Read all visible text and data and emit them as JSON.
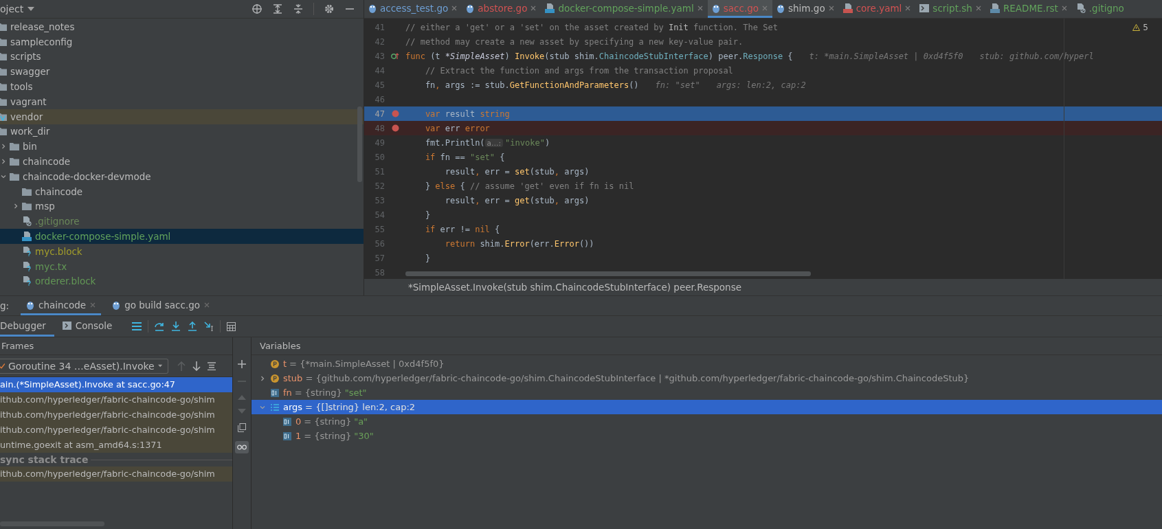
{
  "project_panel": {
    "title": "oject",
    "tree": [
      {
        "label": "release_notes",
        "kind": "folder",
        "selected": false
      },
      {
        "label": "sampleconfig",
        "kind": "folder",
        "selected": false
      },
      {
        "label": "scripts",
        "kind": "folder",
        "selected": false
      },
      {
        "label": "swagger",
        "kind": "folder",
        "selected": false
      },
      {
        "label": "tools",
        "kind": "folder",
        "selected": false
      },
      {
        "label": "vagrant",
        "kind": "folder",
        "selected": false
      },
      {
        "label": "vendor",
        "kind": "vendor",
        "selected": false
      },
      {
        "label": "work_dir",
        "kind": "folder",
        "selected": false,
        "children": [
          {
            "label": "bin",
            "kind": "folder",
            "expanded": false,
            "selected": false
          },
          {
            "label": "chaincode",
            "kind": "folder",
            "expanded": false,
            "selected": false
          },
          {
            "label": "chaincode-docker-devmode",
            "kind": "folder",
            "expanded": true,
            "selected": false,
            "children": [
              {
                "label": "chaincode",
                "kind": "folder",
                "selected": false
              },
              {
                "label": "msp",
                "kind": "folder",
                "expanded": false,
                "selected": false
              },
              {
                "label": ".gitignore",
                "kind": "ignored",
                "color": "#6a8759",
                "selected": false
              },
              {
                "label": "docker-compose-simple.yaml",
                "kind": "compose",
                "color": "#62a35c",
                "selected": true
              },
              {
                "label": "myc.block",
                "kind": "unknown",
                "color": "#a39e2a",
                "selected": false
              },
              {
                "label": "myc.tx",
                "kind": "unknown",
                "color": "#629755",
                "selected": false
              },
              {
                "label": "orderer.block",
                "kind": "unknown",
                "color": "#629755",
                "selected": false
              }
            ]
          }
        ]
      }
    ]
  },
  "editor": {
    "tabs": [
      {
        "label": "access_test.go",
        "kind": "go",
        "color": "#6e9fd4",
        "selected": false
      },
      {
        "label": "abstore.go",
        "kind": "go",
        "color": "#d25252",
        "selected": false
      },
      {
        "label": "docker-compose-simple.yaml",
        "kind": "compose",
        "color": "#62a35c",
        "selected": false
      },
      {
        "label": "sacc.go",
        "kind": "go",
        "color": "#d25252",
        "selected": true
      },
      {
        "label": "shim.go",
        "kind": "go",
        "color": "#bbbbbb",
        "selected": false
      },
      {
        "label": "core.yaml",
        "kind": "yaml",
        "color": "#d25252",
        "selected": false
      },
      {
        "label": "script.sh",
        "kind": "shell",
        "color": "#62a35c",
        "selected": false
      },
      {
        "label": "README.rst",
        "kind": "rst",
        "color": "#62a35c",
        "selected": false
      },
      {
        "label": ".gitigno",
        "kind": "ignored",
        "color": "#62a35c",
        "selected": false
      }
    ],
    "warnings": "5",
    "lines": [
      {
        "number": "41",
        "breakpoint": false,
        "current": false,
        "tokens": [
          {
            "kind": "cm",
            "text": "// either a 'get' or a 'set' on the asset created by "
          },
          {
            "kind": "cmref",
            "text": "Init"
          },
          {
            "kind": "cm",
            "text": " function. The Set"
          }
        ]
      },
      {
        "number": "42",
        "breakpoint": false,
        "current": false,
        "tokens": [
          {
            "kind": "cm",
            "text": "// method may create a new asset by specifying a new key-value pair."
          }
        ]
      },
      {
        "number": "43",
        "breakpoint": false,
        "current": false,
        "kind": "implements",
        "tokens": [
          {
            "kind": "kw",
            "text": "func"
          },
          {
            "kind": "id",
            "text": " (t "
          },
          {
            "kind": "type",
            "text": "*SimpleAsset"
          },
          {
            "kind": "id",
            "text": ") "
          },
          {
            "kind": "fn",
            "text": "Invoke"
          },
          {
            "kind": "id",
            "text": "(stub shim."
          },
          {
            "kind": "iface",
            "text": "ChaincodeStubInterface"
          },
          {
            "kind": "id",
            "text": ") peer."
          },
          {
            "kind": "iface",
            "text": "Response"
          },
          {
            "kind": "id",
            "text": " {"
          },
          {
            "kind": "hint",
            "text": "t: *main.SimpleAsset | 0xd4f5f0"
          },
          {
            "kind": "hint",
            "text": "stub: github.com/hyperl"
          }
        ]
      },
      {
        "number": "44",
        "breakpoint": false,
        "current": false,
        "tokens": [
          {
            "kind": "cm",
            "text": "    // Extract the function and args from the transaction proposal"
          }
        ]
      },
      {
        "number": "45",
        "breakpoint": false,
        "current": false,
        "tokens": [
          {
            "kind": "id",
            "text": "    fn"
          },
          {
            "kind": "kw",
            "text": ","
          },
          {
            "kind": "id",
            "text": " args := stub."
          },
          {
            "kind": "fn",
            "text": "GetFunctionAndParameters"
          },
          {
            "kind": "id",
            "text": "()"
          },
          {
            "kind": "hint",
            "text": "fn: \"set\""
          },
          {
            "kind": "hint",
            "text": "args: len:2, cap:2"
          }
        ]
      },
      {
        "number": "46",
        "breakpoint": false,
        "current": false
      },
      {
        "number": "47",
        "breakpoint": true,
        "current": true,
        "tokens": [
          {
            "kind": "kw",
            "text": "    var"
          },
          {
            "kind": "id",
            "text": " result "
          },
          {
            "kind": "kw",
            "text": "string"
          }
        ]
      },
      {
        "number": "48",
        "breakpoint": true,
        "current": false,
        "tokens": [
          {
            "kind": "kw",
            "text": "    var"
          },
          {
            "kind": "id",
            "text": " err "
          },
          {
            "kind": "kw",
            "text": "error"
          }
        ]
      },
      {
        "number": "49",
        "breakpoint": false,
        "current": false,
        "tokens": [
          {
            "kind": "id",
            "text": "    fmt.Println("
          },
          {
            "kind": "param",
            "text": "a…:"
          },
          {
            "kind": "str",
            "text": "\"invoke\""
          },
          {
            "kind": "id",
            "text": ")"
          }
        ]
      },
      {
        "number": "50",
        "breakpoint": false,
        "current": false,
        "tokens": [
          {
            "kind": "kw",
            "text": "    if"
          },
          {
            "kind": "id",
            "text": " fn == "
          },
          {
            "kind": "str",
            "text": "\"set\""
          },
          {
            "kind": "id",
            "text": " {"
          }
        ]
      },
      {
        "number": "51",
        "breakpoint": false,
        "current": false,
        "tokens": [
          {
            "kind": "id",
            "text": "        result"
          },
          {
            "kind": "kw",
            "text": ","
          },
          {
            "kind": "id",
            "text": " err = "
          },
          {
            "kind": "fn",
            "text": "set"
          },
          {
            "kind": "id",
            "text": "(stub"
          },
          {
            "kind": "kw",
            "text": ","
          },
          {
            "kind": "id",
            "text": " args)"
          }
        ]
      },
      {
        "number": "52",
        "breakpoint": false,
        "current": false,
        "tokens": [
          {
            "kind": "id",
            "text": "    } "
          },
          {
            "kind": "kw",
            "text": "else"
          },
          {
            "kind": "id",
            "text": " { "
          },
          {
            "kind": "cm",
            "text": "// assume 'get' even if fn is nil"
          }
        ]
      },
      {
        "number": "53",
        "breakpoint": false,
        "current": false,
        "tokens": [
          {
            "kind": "id",
            "text": "        result"
          },
          {
            "kind": "kw",
            "text": ","
          },
          {
            "kind": "id",
            "text": " err = "
          },
          {
            "kind": "fn",
            "text": "get"
          },
          {
            "kind": "id",
            "text": "(stub"
          },
          {
            "kind": "kw",
            "text": ","
          },
          {
            "kind": "id",
            "text": " args)"
          }
        ]
      },
      {
        "number": "54",
        "breakpoint": false,
        "current": false,
        "tokens": [
          {
            "kind": "id",
            "text": "    }"
          }
        ]
      },
      {
        "number": "55",
        "breakpoint": false,
        "current": false,
        "tokens": [
          {
            "kind": "kw",
            "text": "    if"
          },
          {
            "kind": "id",
            "text": " err != "
          },
          {
            "kind": "kw",
            "text": "nil"
          },
          {
            "kind": "id",
            "text": " {"
          }
        ]
      },
      {
        "number": "56",
        "breakpoint": false,
        "current": false,
        "tokens": [
          {
            "kind": "kw",
            "text": "        return"
          },
          {
            "kind": "id",
            "text": " shim."
          },
          {
            "kind": "fn",
            "text": "Error"
          },
          {
            "kind": "id",
            "text": "(err."
          },
          {
            "kind": "fn",
            "text": "Error"
          },
          {
            "kind": "id",
            "text": "())"
          }
        ]
      },
      {
        "number": "57",
        "breakpoint": false,
        "current": false,
        "tokens": [
          {
            "kind": "id",
            "text": "    }"
          }
        ]
      },
      {
        "number": "58",
        "breakpoint": false,
        "current": false
      }
    ],
    "signature": "*SimpleAsset.Invoke(stub shim.ChaincodeStubInterface) peer.Response"
  },
  "debug": {
    "label": "g:",
    "sessions": [
      {
        "label": "chaincode",
        "selected": true
      },
      {
        "label": "go build sacc.go",
        "selected": false
      }
    ],
    "views": [
      {
        "label": "Debugger",
        "selected": true
      },
      {
        "label": "Console",
        "selected": false
      }
    ],
    "frames_title": "Frames",
    "goroutine": "Goroutine 34 …eAsset).Invoke",
    "frames": [
      {
        "kind": "frame",
        "text": "ain.(*SimpleAsset).Invoke at sacc.go:47",
        "selected": true
      },
      {
        "kind": "frame",
        "text": "ithub.com/hyperledger/fabric-chaincode-go/shim",
        "selected": false
      },
      {
        "kind": "frame",
        "text": "ithub.com/hyperledger/fabric-chaincode-go/shim",
        "selected": false
      },
      {
        "kind": "frame",
        "text": "ithub.com/hyperledger/fabric-chaincode-go/shim",
        "selected": false
      },
      {
        "kind": "frame",
        "text": "untime.goexit at asm_amd64.s:1371",
        "selected": false
      },
      {
        "kind": "separator",
        "text": "sync stack trace"
      },
      {
        "kind": "frame",
        "text": "ithub.com/hyperledger/fabric-chaincode-go/shim",
        "selected": false
      }
    ],
    "variables_title": "Variables",
    "variables": [
      {
        "name": "t",
        "kind": "pointer",
        "type": "= {*main.SimpleAsset | 0xd4f5f0}",
        "selected": false
      },
      {
        "name": "stub",
        "kind": "pointer",
        "expanded": false,
        "type": "= {github.com/hyperledger/fabric-chaincode-go/shim.ChaincodeStubInterface | *github.com/hyperledger/fabric-chaincode-go/shim.ChaincodeStub}",
        "selected": false
      },
      {
        "name": "fn",
        "kind": "string",
        "type": "= {string}",
        "value": "\"set\"",
        "selected": false
      },
      {
        "name": "args",
        "kind": "slice",
        "expanded": true,
        "type": "= {[]string} len:2, cap:2",
        "selected": true,
        "children": [
          {
            "name": "0",
            "kind": "string",
            "type": "= {string}",
            "value": "\"a\"",
            "selected": false
          },
          {
            "name": "1",
            "kind": "string",
            "type": "= {string}",
            "value": "\"30\"",
            "selected": false
          }
        ]
      }
    ]
  }
}
